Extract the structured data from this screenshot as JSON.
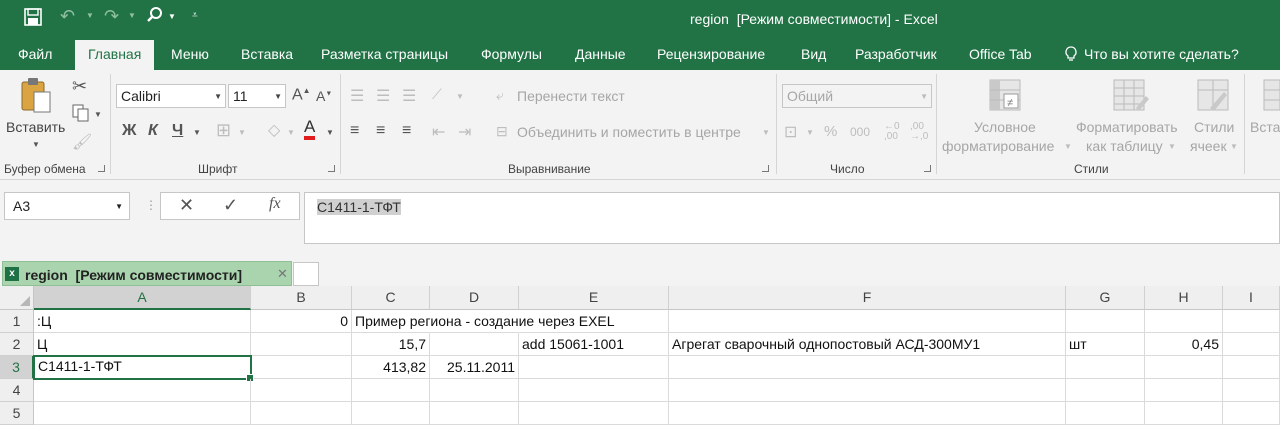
{
  "titlebar": {
    "title": "region  [Режим совместимости] - Excel",
    "save_icon": "save-icon",
    "undo_icon": "undo-icon",
    "redo_icon": "redo-icon",
    "search_icon": "magnifier-icon",
    "customize_icon": "customize-qat-icon"
  },
  "tabs": [
    "Файл",
    "Главная",
    "Меню",
    "Вставка",
    "Разметка страницы",
    "Формулы",
    "Данные",
    "Рецензирование",
    "Вид",
    "Разработчик",
    "Office Tab"
  ],
  "tell_me": "Что вы хотите сделать?",
  "ribbon": {
    "clipboard": {
      "paste": "Вставить",
      "label": "Буфер обмена"
    },
    "font": {
      "name": "Calibri",
      "size": "11",
      "bold": "Ж",
      "italic": "К",
      "underline": "Ч",
      "label": "Шрифт"
    },
    "alignment": {
      "wrap": "Перенести текст",
      "merge": "Объединить и поместить в центре",
      "label": "Выравнивание"
    },
    "number": {
      "format": "Общий",
      "percent": "%",
      "thousands": "000",
      "label": "Число"
    },
    "styles": {
      "conditional_1": "Условное",
      "conditional_2": "форматирование",
      "format_table_1": "Форматировать",
      "format_table_2": "как таблицу",
      "cell_styles_1": "Стили",
      "cell_styles_2": "ячеек",
      "insert": "Вста",
      "label": "Стили"
    }
  },
  "formula_bar": {
    "name_box": "A3",
    "content": "С1411-1-ТФТ"
  },
  "doc_tab": {
    "title": "region  [Режим совместимости]"
  },
  "columns": [
    "A",
    "B",
    "C",
    "D",
    "E",
    "F",
    "G",
    "H",
    "I"
  ],
  "rows": [
    "1",
    "2",
    "3",
    "4",
    "5"
  ],
  "cells": {
    "A1": ":Ц",
    "B1": "0",
    "C1": "Пример региона - создание через EXEL",
    "A2": "Ц",
    "C2": "15,7",
    "E2": "add 15061-1001",
    "F2": "Агрегат сварочный однопостовый АСД-300МУ1",
    "G2": "шт",
    "H2": "0,45",
    "A3": "С1411-1-ТФТ",
    "C3": "413,82",
    "D3": "25.11.2011"
  },
  "colors": {
    "accent": "#217346",
    "ribbon_bg": "#f3f3f3",
    "doc_tab": "#a9d4ae"
  }
}
